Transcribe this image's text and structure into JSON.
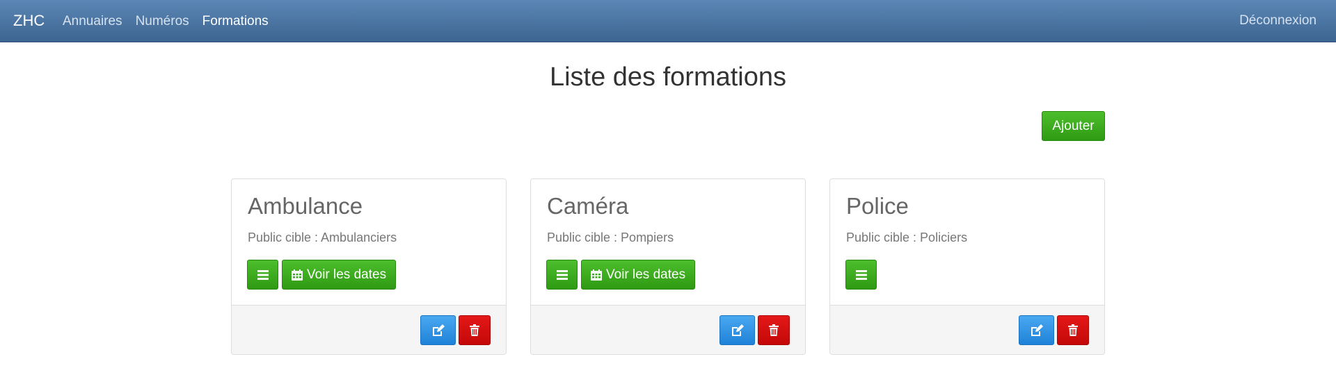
{
  "navbar": {
    "brand": "ZHC",
    "links": [
      {
        "label": "Annuaires"
      },
      {
        "label": "Numéros"
      },
      {
        "label": "Formations"
      }
    ],
    "logout": "Déconnexion"
  },
  "main": {
    "title": "Liste des formations",
    "add_label": "Ajouter"
  },
  "cards": [
    {
      "title": "Ambulance",
      "subtitle": "Public cible : Ambulanciers",
      "dates_label": "Voir les dates"
    },
    {
      "title": "Caméra",
      "subtitle": "Public cible : Pompiers",
      "dates_label": "Voir les dates"
    },
    {
      "title": "Police",
      "subtitle": "Public cible : Policiers"
    }
  ],
  "icons": {
    "list": "list-icon",
    "calendar": "calendar-icon",
    "edit": "edit-icon",
    "delete": "trash-icon"
  },
  "colors": {
    "navbar": "#4a74a3",
    "success": "#3aab1f",
    "primary": "#2f94e4",
    "danger": "#d41010"
  }
}
